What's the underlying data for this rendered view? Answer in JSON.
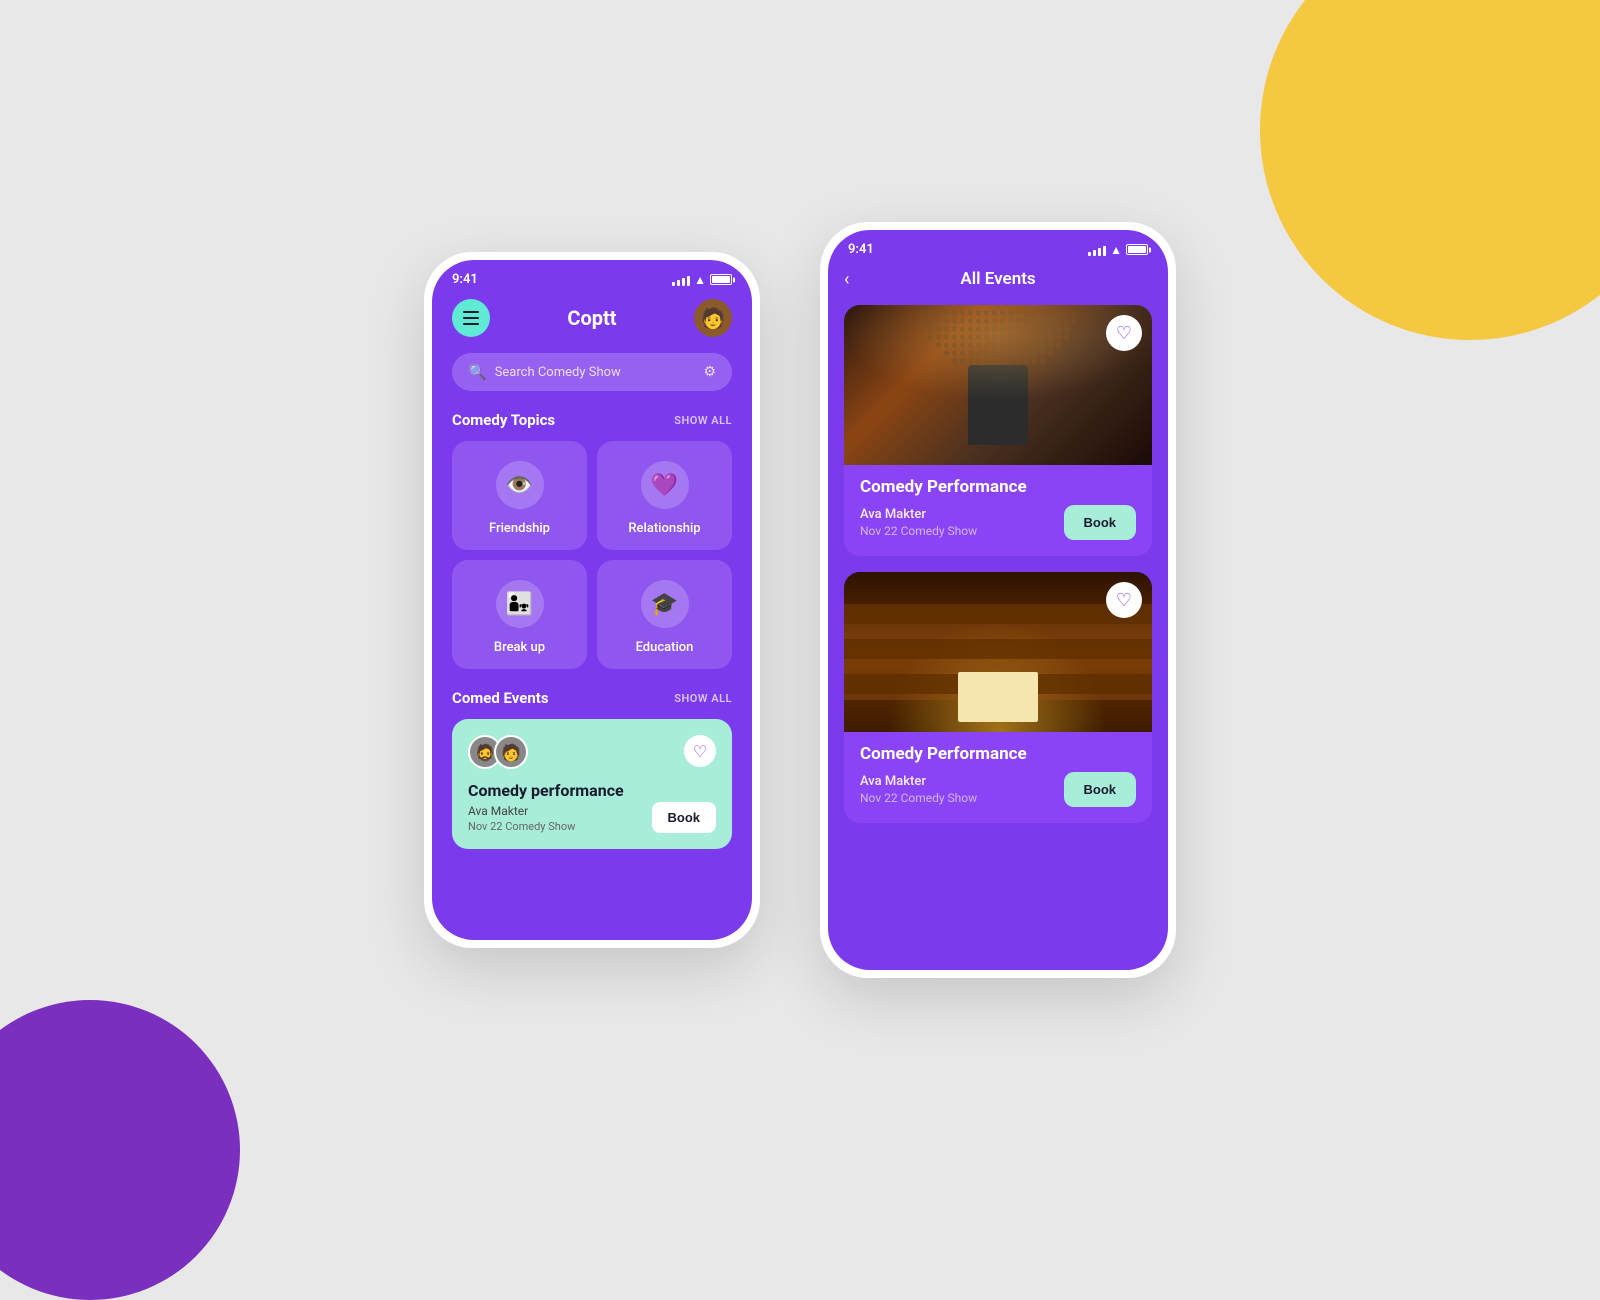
{
  "background": {
    "primary": "#e8e8e8",
    "circle_yellow": "#F5C842",
    "circle_purple": "#7B2FBE"
  },
  "phone1": {
    "status_bar": {
      "time": "9:41"
    },
    "header": {
      "title": "Coptt",
      "menu_label": "Menu",
      "avatar_label": "User Avatar"
    },
    "search": {
      "placeholder": "Search Comedy Show"
    },
    "topics": {
      "section_title": "Comedy Topics",
      "show_all": "SHOW ALL",
      "items": [
        {
          "icon": "👁️",
          "label": "Friendship"
        },
        {
          "icon": "💜",
          "label": "Relationship"
        },
        {
          "icon": "👨‍👧",
          "label": "Break up"
        },
        {
          "icon": "🎓",
          "label": "Education"
        }
      ]
    },
    "events": {
      "section_title": "Comed Events",
      "show_all": "SHOW ALL",
      "card": {
        "title": "Comedy performance",
        "performer": "Ava Makter",
        "date": "Nov 22 Comedy Show",
        "book_label": "Book"
      }
    }
  },
  "phone2": {
    "status_bar": {
      "time": "9:41"
    },
    "header": {
      "title": "All Events",
      "back_label": "Back"
    },
    "events": [
      {
        "title": "Comedy Performance",
        "performer": "Ava Makter",
        "date": "Nov 22 Comedy Show",
        "book_label": "Book",
        "image_type": "concert"
      },
      {
        "title": "Comedy Performance",
        "performer": "Ava Makter",
        "date": "Nov 22 Comedy Show",
        "book_label": "Book",
        "image_type": "theater"
      }
    ]
  }
}
